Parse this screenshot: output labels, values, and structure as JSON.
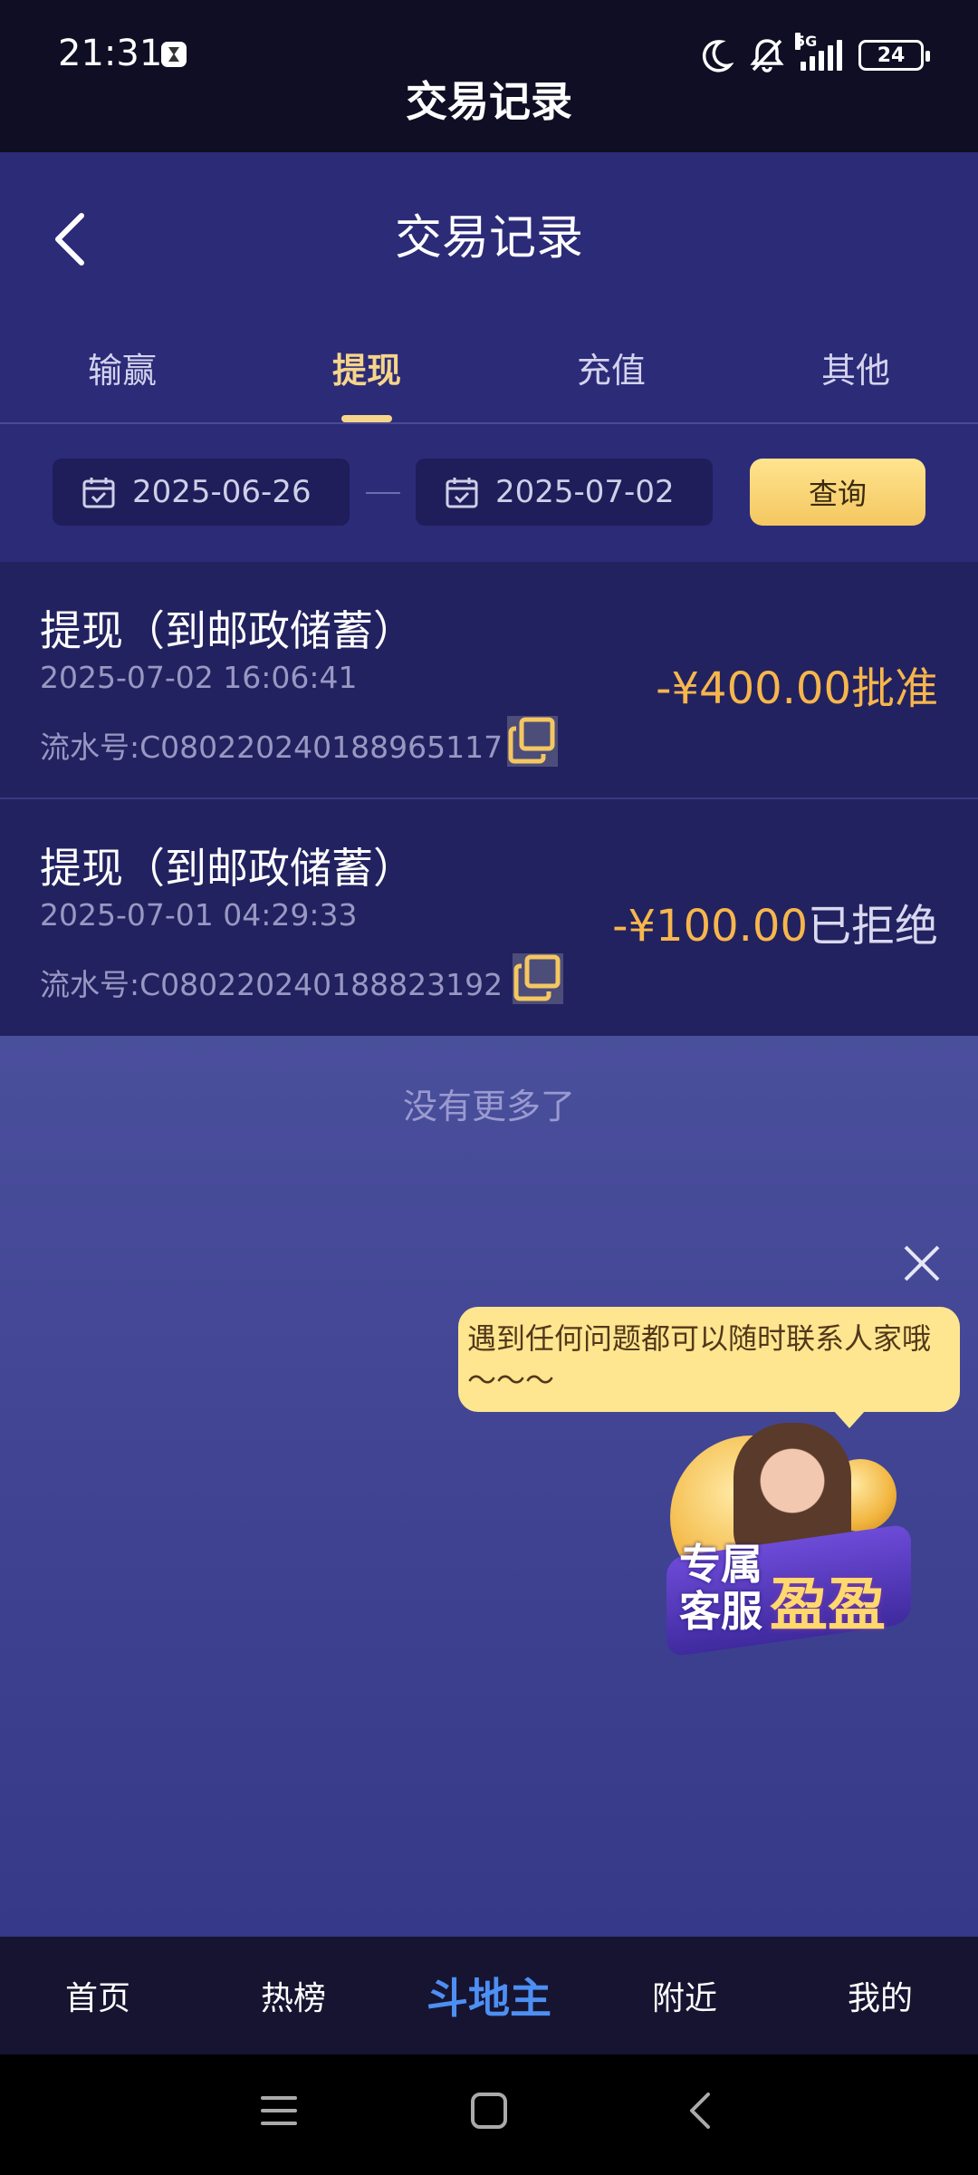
{
  "status_bar": {
    "time": "21:31",
    "network": "5G",
    "battery": "24",
    "screen_title": "交易记录",
    "icons": [
      "hourglass-icon",
      "moon-icon",
      "bell-off-icon",
      "signal-icon",
      "battery-icon"
    ]
  },
  "header": {
    "title": "交易记录",
    "back_icon": "chevron-left-icon"
  },
  "tabs": [
    {
      "label": "输赢",
      "active": false
    },
    {
      "label": "提现",
      "active": true
    },
    {
      "label": "充值",
      "active": false
    },
    {
      "label": "其他",
      "active": false
    }
  ],
  "filter": {
    "start_date": "2025-06-26",
    "end_date": "2025-07-02",
    "query_label": "查询"
  },
  "records": [
    {
      "title": "提现（到邮政储蓄）",
      "time": "2025-07-02 16:06:41",
      "serial": "流水号:C080220240188965117",
      "amount": "-¥400.00",
      "status": "批准"
    },
    {
      "title": "提现（到邮政储蓄）",
      "time": "2025-07-01 04:29:33",
      "serial": "流水号:C080220240188823192",
      "amount": "-¥100.00",
      "status": "已拒绝"
    }
  ],
  "list_end_text": "没有更多了",
  "support_popup": {
    "message": "遇到任何问题都可以随时联系人家哦～～～",
    "badge_text_1": "专属",
    "badge_text_2": "客服",
    "badge_name": "盈盈"
  },
  "bottom_nav": [
    {
      "label": "首页",
      "active": false
    },
    {
      "label": "热榜",
      "active": false
    },
    {
      "label": "斗地主",
      "active": true
    },
    {
      "label": "附近",
      "active": false
    },
    {
      "label": "我的",
      "active": false
    }
  ],
  "colors": {
    "accent_gold": "#f6d58a",
    "amount_orange": "#f7b64c",
    "nav_active_blue": "#4d8ff2",
    "header_bg": "#2c2b78"
  }
}
